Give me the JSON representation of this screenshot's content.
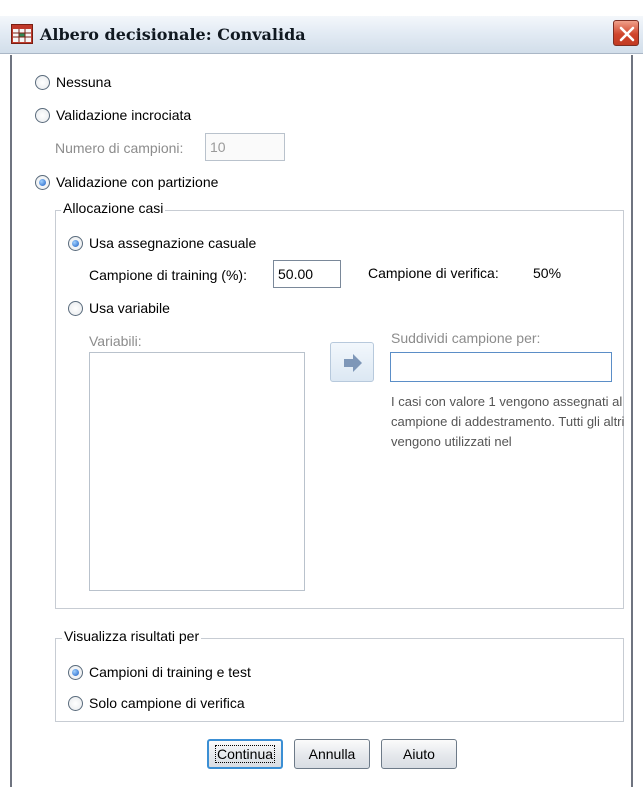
{
  "window": {
    "title": "Albero decisionale: Convalida",
    "icon": "tree-grid-icon",
    "close_icon": "close-icon"
  },
  "validation": {
    "none_label": "Nessuna",
    "cross_label": "Validazione incrociata",
    "samples_label": "Numero di campioni:",
    "samples_value": "10",
    "partition_label": "Validazione con partizione",
    "selected": "partition"
  },
  "allocation": {
    "legend": "Allocazione casi",
    "random_label": "Usa assegnazione casuale",
    "training_label": "Campione di training (%):",
    "training_value": "50.00",
    "verify_label": "Campione di verifica:",
    "verify_value": "50%",
    "variable_label": "Usa variabile",
    "variables_label": "Variabili:",
    "split_label": "Suddividi campione per:",
    "split_value": "",
    "info_text": "I casi con valore 1 vengono assegnati al campione di addestramento. Tutti gli altri vengono utilizzati nel",
    "selected": "random"
  },
  "display": {
    "legend": "Visualizza risultati per",
    "both_label": "Campioni di training e test",
    "test_only_label": "Solo campione di verifica",
    "selected": "both"
  },
  "buttons": {
    "continue": "Continua",
    "cancel": "Annulla",
    "help": "Aiuto"
  },
  "colors": {
    "accent": "#1d5fc4",
    "close": "#c23a22"
  }
}
